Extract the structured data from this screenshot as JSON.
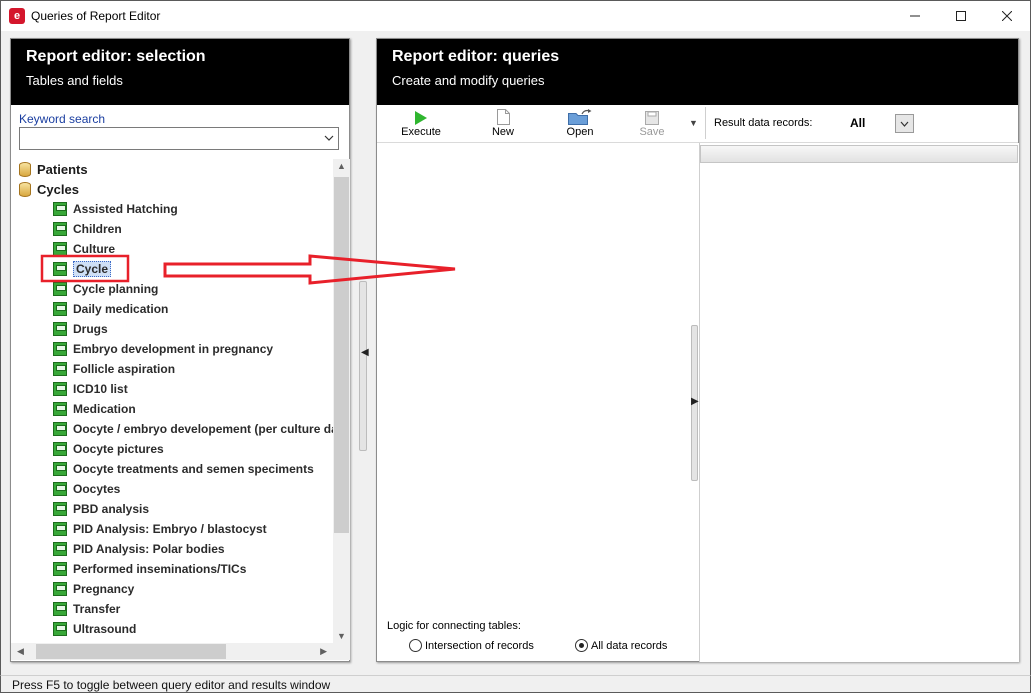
{
  "window": {
    "title": "Queries of Report Editor",
    "icon_letter": "e"
  },
  "left_panel": {
    "title": "Report editor: selection",
    "subtitle": "Tables and fields",
    "keyword_label": "Keyword search",
    "keyword_value": "",
    "tree": {
      "roots": [
        {
          "label": "Patients"
        },
        {
          "label": "Cycles"
        }
      ],
      "children": [
        {
          "label": "Assisted Hatching"
        },
        {
          "label": "Children"
        },
        {
          "label": "Culture"
        },
        {
          "label": "Cycle"
        },
        {
          "label": "Cycle planning"
        },
        {
          "label": "Daily medication"
        },
        {
          "label": "Drugs"
        },
        {
          "label": "Embryo development in pregnancy"
        },
        {
          "label": "Follicle aspiration"
        },
        {
          "label": "ICD10 list"
        },
        {
          "label": "Medication"
        },
        {
          "label": "Oocyte / embryo developement (per culture da"
        },
        {
          "label": "Oocyte pictures"
        },
        {
          "label": "Oocyte treatments and semen speciments"
        },
        {
          "label": "Oocytes"
        },
        {
          "label": "PBD analysis"
        },
        {
          "label": "PID Analysis: Embryo / blastocyst"
        },
        {
          "label": "PID Analysis: Polar bodies"
        },
        {
          "label": "Performed inseminations/TICs"
        },
        {
          "label": "Pregnancy"
        },
        {
          "label": "Transfer"
        },
        {
          "label": "Ultrasound"
        }
      ],
      "selected": "Cycle"
    }
  },
  "right_panel": {
    "title": "Report editor: queries",
    "subtitle": "Create and modify queries",
    "toolbar": {
      "execute_label": "Execute",
      "new_label": "New",
      "open_label": "Open",
      "save_label": "Save"
    },
    "result_records_label": "Result data records:",
    "result_records_value": "All",
    "logic_label": "Logic for connecting tables:",
    "logic_options": [
      "Intersection of records",
      "All data records"
    ],
    "logic_selected": "All data records"
  },
  "status_bar": {
    "text": "Press F5 to toggle between query editor and results window"
  },
  "colors": {
    "header_bg": "#000000",
    "highlight_red": "#e8202a",
    "execute_green": "#2fb62f"
  }
}
